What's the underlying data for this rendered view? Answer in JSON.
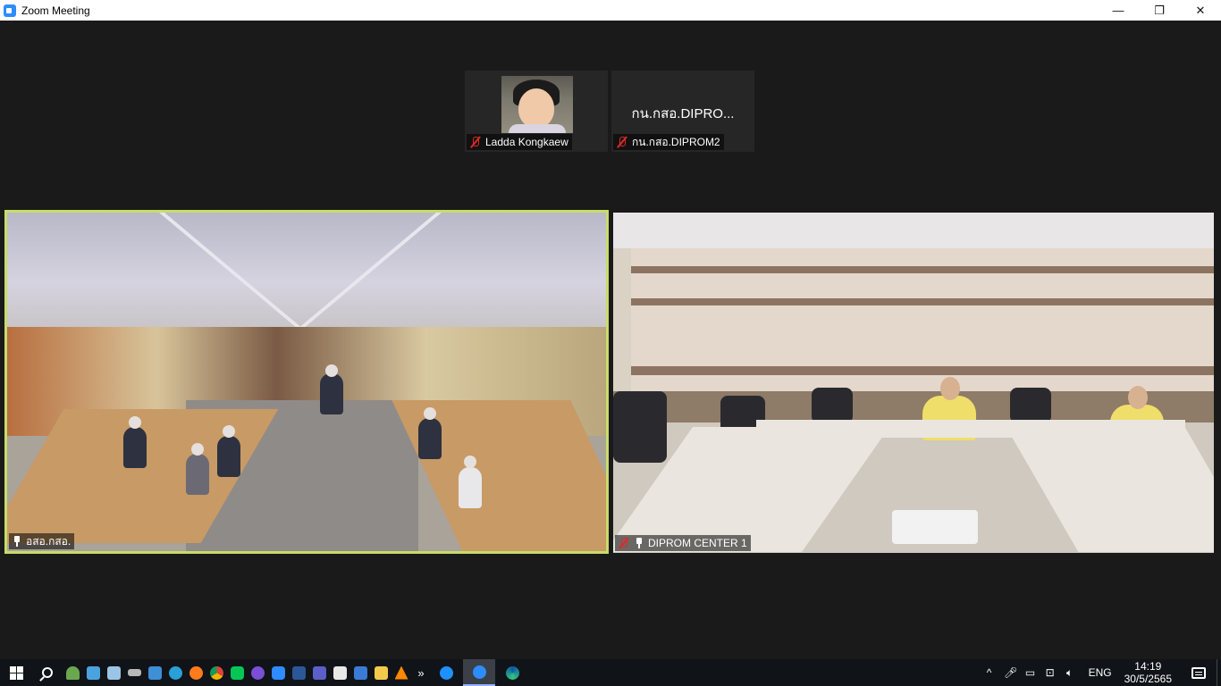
{
  "window": {
    "title": "Zoom Meeting",
    "minimize": "—",
    "restore": "❐",
    "close": "✕"
  },
  "participants_thumbs": [
    {
      "name": "Ladda Kongkaew",
      "muted": true,
      "has_video": true
    },
    {
      "name": "กน.กสอ.DIPROM2",
      "display_name": "กน.กสอ.DIPRO...",
      "muted": true,
      "has_video": false
    }
  ],
  "main_videos": [
    {
      "name": "อสอ.กสอ.",
      "pinned": true,
      "muted": false,
      "active_speaker": true
    },
    {
      "name": "DIPROM CENTER 1",
      "pinned": true,
      "muted": true,
      "active_speaker": false
    }
  ],
  "taskbar": {
    "apps": [
      "user-icon",
      "desktop-icon",
      "file-explorer-icon",
      "drive-icon",
      "network-icon",
      "edge-icon",
      "firefox-icon",
      "chrome-icon",
      "line-icon",
      "circle-app-icon",
      "zoom-icon",
      "word-icon",
      "teams-icon",
      "film-icon",
      "ten-icon",
      "folder-icon",
      "vlc-icon"
    ],
    "overflow": "»",
    "pinned": [
      "ie-icon",
      "zoom-active-icon",
      "edge-new-icon"
    ],
    "tray": {
      "chevron": "^",
      "language": "ENG",
      "time": "14:19",
      "date": "30/5/2565"
    }
  },
  "colors": {
    "active_speaker_border": "#c8dc6a",
    "mute_red": "#e02828",
    "zoom_blue": "#2d8cff",
    "taskbar_bg": "#101318"
  }
}
